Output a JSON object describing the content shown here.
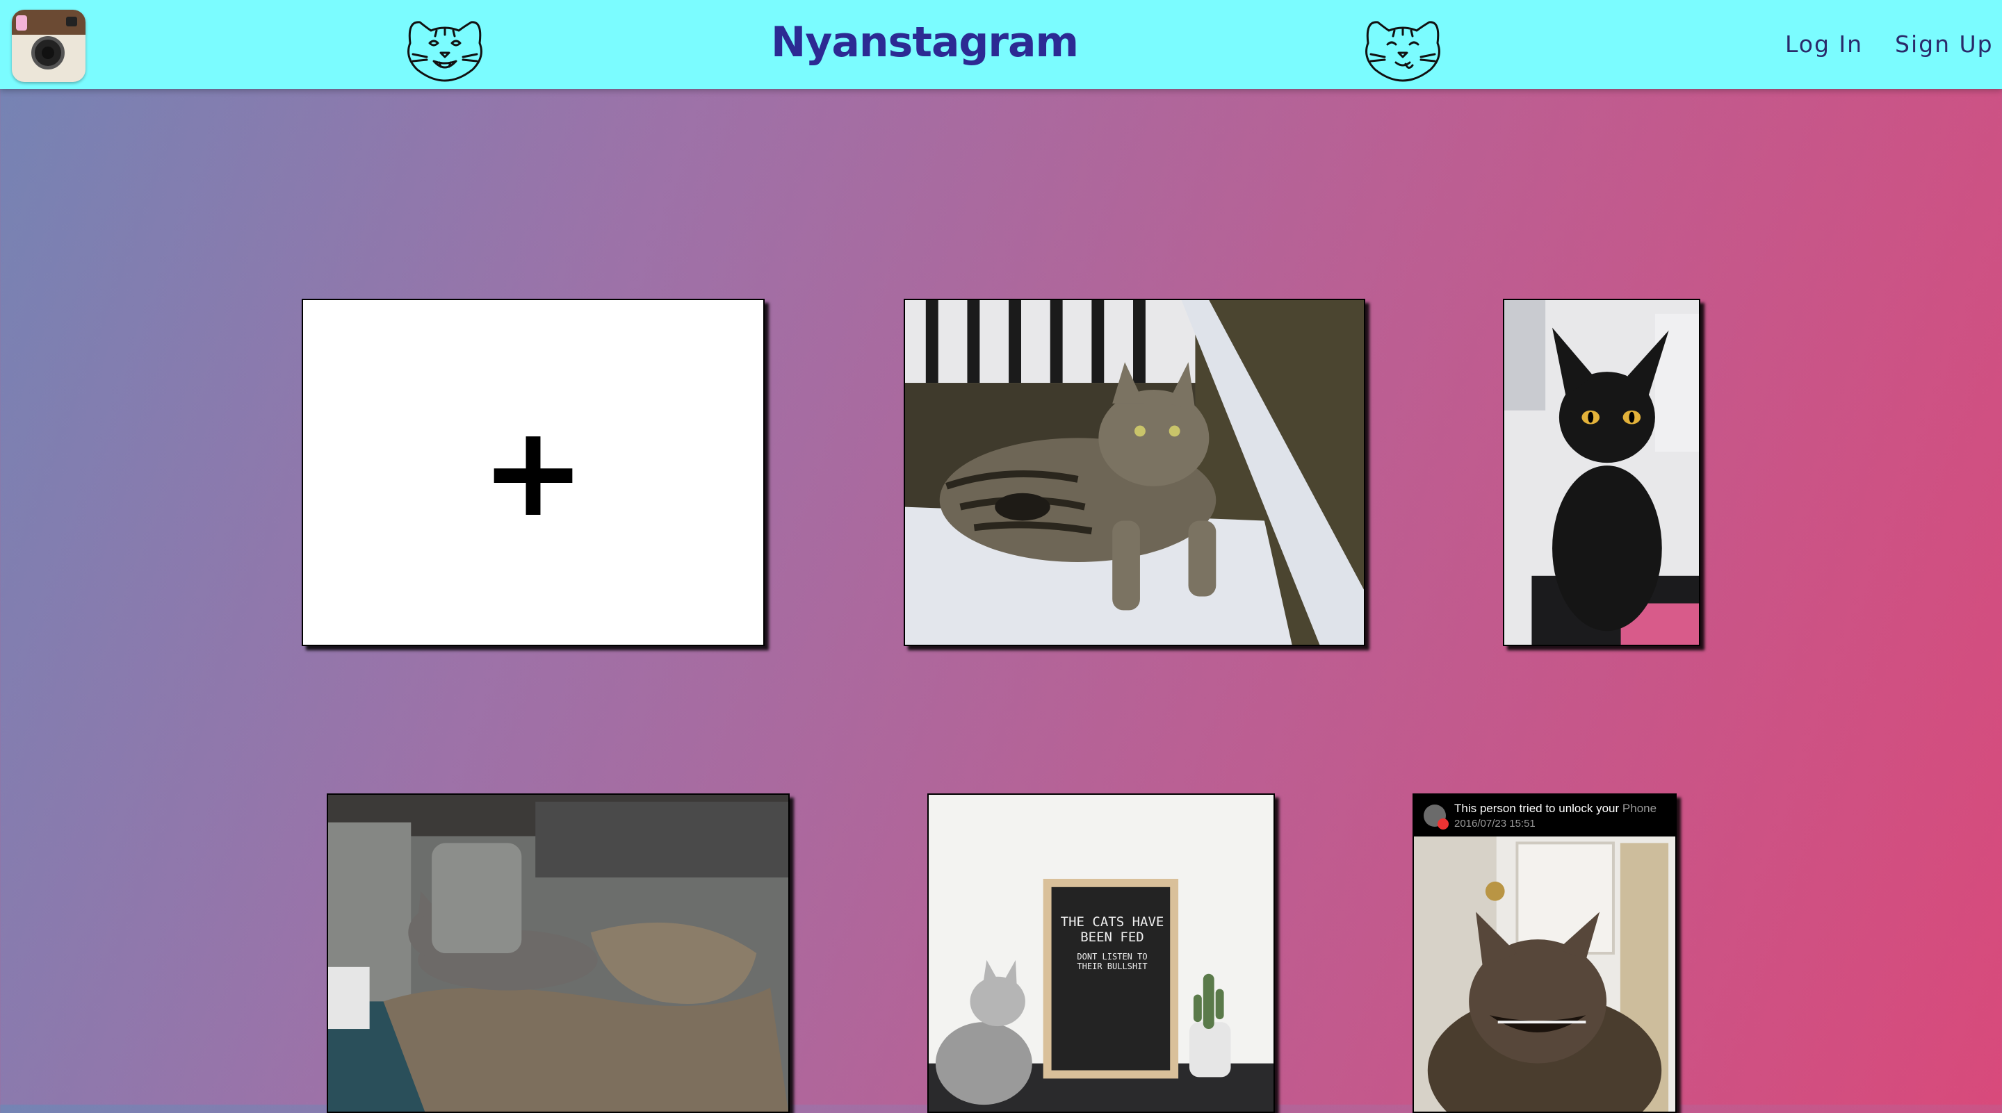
{
  "app": {
    "brand": "Nyanstagram",
    "nav": {
      "login": "Log In",
      "signup": "Sign Up"
    },
    "colors": {
      "navbar": "#7bfcff",
      "brand_text": "#2c2a93",
      "background_left": "#7484b4",
      "background_right": "#d84a7b"
    }
  },
  "icons": {
    "logo": "camera-icon",
    "left_cat": "cat-face-icon",
    "right_cat": "cat-face-icon",
    "add": "plus-icon"
  },
  "add_card": {
    "label": "+"
  },
  "photos": {
    "photo4": {
      "notification_line": "This person tried to unlock your",
      "notification_dim": "Phone",
      "notification_time": "2016/07/23 15:51"
    },
    "photo3": {
      "board_line1": "THE CATS HAVE",
      "board_line2": "BEEN FED",
      "board_line3": "DONT LISTEN TO",
      "board_line4": "THEIR BULLSHIT"
    }
  }
}
